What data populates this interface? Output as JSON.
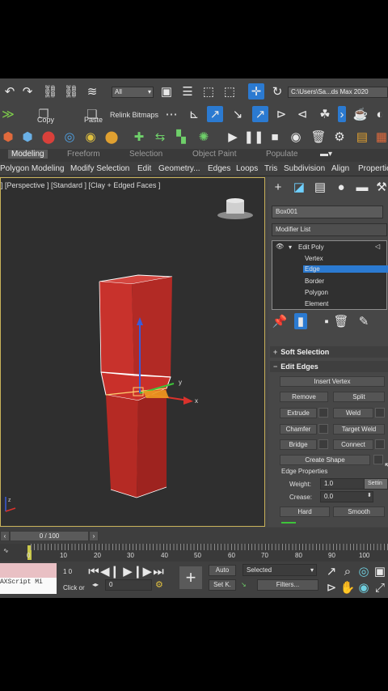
{
  "toolbar": {
    "selection_filter": "All",
    "copy_label": "Copy",
    "paste_label": "Paste",
    "relink_label": "Relink Bitmaps",
    "project_path": "C:\\Users\\Sa...ds Max 2020"
  },
  "ribbon": {
    "tabs": [
      "Modeling",
      "Freeform",
      "Selection",
      "Object Paint",
      "Populate"
    ],
    "items": [
      "Polygon Modeling",
      "Modify Selection",
      "Edit",
      "Geometry...",
      "Edges",
      "Loops",
      "Tris",
      "Subdivision",
      "Align",
      "Properties"
    ]
  },
  "viewport": {
    "label": "] [Perspective ] [Standard ] [Clay + Edged Faces ]",
    "axis_x": "x",
    "axis_y": "y",
    "axis_z": "z"
  },
  "command_panel": {
    "object_name": "Box001",
    "modifier_list": "Modifier List",
    "stack": {
      "modifier": "Edit Poly",
      "subobjects": [
        "Vertex",
        "Edge",
        "Border",
        "Polygon",
        "Element"
      ],
      "selected": "Edge"
    },
    "soft_selection": "Soft Selection",
    "edit_edges": "Edit Edges",
    "buttons": {
      "insert_vertex": "Insert Vertex",
      "remove": "Remove",
      "split": "Split",
      "extrude": "Extrude",
      "weld": "Weld",
      "chamfer": "Chamfer",
      "target_weld": "Target Weld",
      "bridge": "Bridge",
      "connect": "Connect",
      "create_shape": "Create Shape"
    },
    "edge_properties": "Edge Properties",
    "weight_label": "Weight:",
    "weight_value": "1.0",
    "crease_label": "Crease:",
    "crease_value": "0.0",
    "settings_tooltip": "Settin",
    "hard": "Hard",
    "smooth": "Smooth"
  },
  "timeline": {
    "frame": "0 / 100",
    "ticks": [
      "0",
      "10",
      "20",
      "30",
      "40",
      "50",
      "60",
      "70",
      "80",
      "90",
      "100"
    ]
  },
  "status": {
    "maxscript": "AXScript Mi",
    "click_hint": "Click or",
    "frame_field": "0",
    "auto_key": "Auto",
    "set_key": "Set K.",
    "selected_dropdown": "Selected",
    "filters": "Filters...",
    "left_counter": "1 0"
  },
  "colors": {
    "accent_blue": "#2b7ad1",
    "model_red": "#c8322c",
    "viewport_border": "#c9b25a",
    "timeline_marker": "#c9c84a"
  }
}
